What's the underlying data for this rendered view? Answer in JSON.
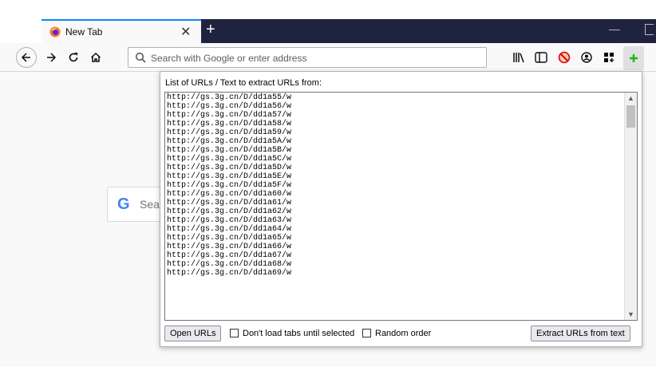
{
  "browser": {
    "tab": {
      "title": "New Tab",
      "close_glyph": "✕",
      "favicon": "firefox-icon"
    },
    "new_tab_glyph": "+",
    "window": {
      "minimize_glyph": "—"
    },
    "nav": {
      "back_icon": "back-arrow-icon",
      "forward_icon": "forward-arrow-icon",
      "reload_icon": "reload-icon",
      "home_icon": "home-icon"
    },
    "urlbar": {
      "placeholder": "Search with Google or enter address",
      "value": ""
    },
    "toolbar_icons": [
      "library-icon",
      "sidebar-icon",
      "blocked-addon-icon",
      "account-icon",
      "grid-icon",
      "url-extension-icon"
    ]
  },
  "newtab_page": {
    "search_logo": "G",
    "search_text": "Sea"
  },
  "popup": {
    "label": "List of URLs / Text to extract URLs from:",
    "urls": [
      "http://gs.3g.cn/D/dd1a55/w",
      "http://gs.3g.cn/D/dd1a56/w",
      "http://gs.3g.cn/D/dd1a57/w",
      "http://gs.3g.cn/D/dd1a58/w",
      "http://gs.3g.cn/D/dd1a59/w",
      "http://gs.3g.cn/D/dd1a5A/w",
      "http://gs.3g.cn/D/dd1a5B/w",
      "http://gs.3g.cn/D/dd1a5C/w",
      "http://gs.3g.cn/D/dd1a5D/w",
      "http://gs.3g.cn/D/dd1a5E/w",
      "http://gs.3g.cn/D/dd1a5F/w",
      "http://gs.3g.cn/D/dd1a60/w",
      "http://gs.3g.cn/D/dd1a61/w",
      "http://gs.3g.cn/D/dd1a62/w",
      "http://gs.3g.cn/D/dd1a63/w",
      "http://gs.3g.cn/D/dd1a64/w",
      "http://gs.3g.cn/D/dd1a65/w",
      "http://gs.3g.cn/D/dd1a66/w",
      "http://gs.3g.cn/D/dd1a67/w",
      "http://gs.3g.cn/D/dd1a68/w",
      "http://gs.3g.cn/D/dd1a69/w"
    ],
    "open_button": "Open URLs",
    "dont_load_label": "Don't load tabs until selected",
    "dont_load_checked": false,
    "random_order_label": "Random order",
    "random_order_checked": false,
    "extract_button": "Extract URLs from text"
  }
}
